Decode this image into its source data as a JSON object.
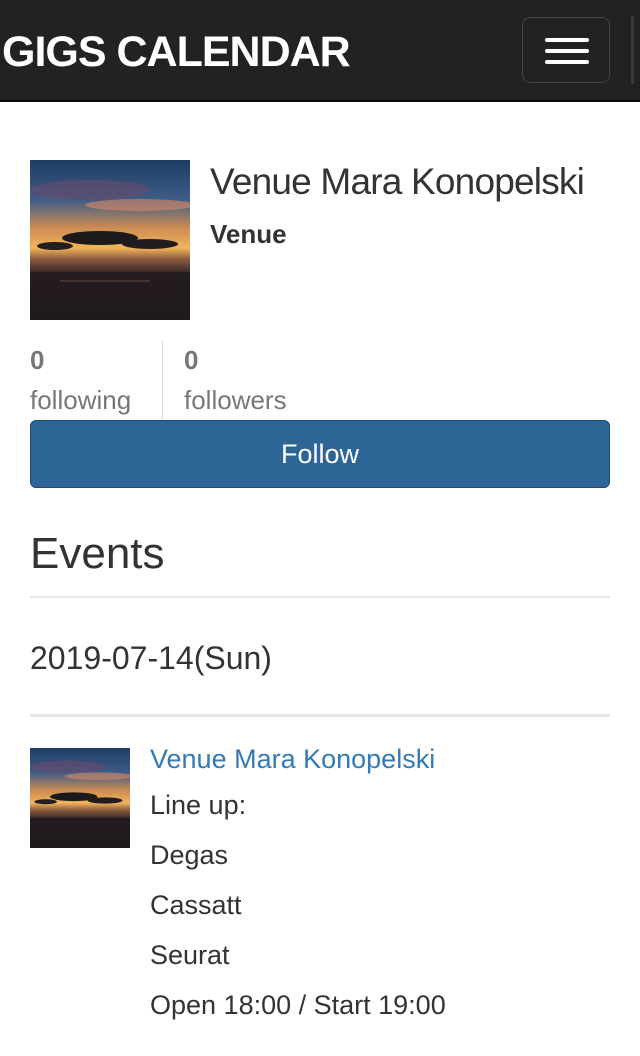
{
  "navbar": {
    "brand": "GIGS CALENDAR",
    "menu_icon": "hamburger-menu-icon"
  },
  "profile": {
    "name": "Venue Mara Konopelski",
    "type": "Venue",
    "image": "sunset-photo"
  },
  "stats": {
    "following_count": "0",
    "following_label": "following",
    "followers_count": "0",
    "followers_label": "followers"
  },
  "follow_button": {
    "label": "Follow"
  },
  "events": {
    "title": "Events",
    "date": "2019-07-14(Sun)",
    "items": [
      {
        "venue": "Venue Mara Konopelski",
        "lineup_label": "Line up:",
        "lineup": [
          "Degas",
          "Cassatt",
          "Seurat"
        ],
        "times": "Open 18:00 / Start 19:00"
      }
    ]
  },
  "colors": {
    "navbar_bg": "#222222",
    "button_bg": "#2c6596",
    "link": "#337ab7",
    "muted": "#777777"
  }
}
